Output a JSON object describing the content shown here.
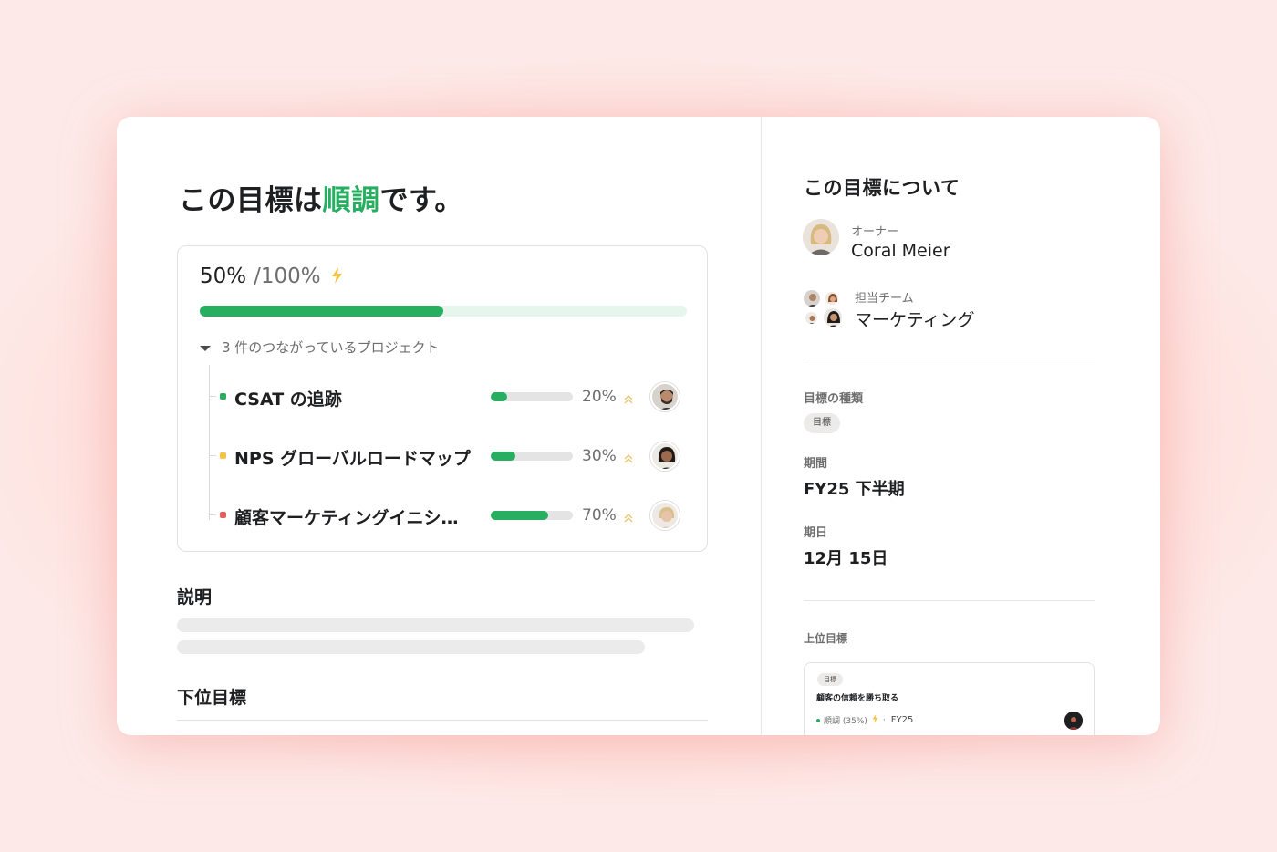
{
  "colors": {
    "accent_green": "#27ae60",
    "warning_yellow": "#f5c242",
    "danger_red": "#ec5d5d",
    "page_background": "#fde9e7"
  },
  "main": {
    "headline_prefix": "この目標は",
    "headline_status": "順調",
    "headline_suffix": "です。",
    "progress": {
      "current": "50%",
      "total": "/100%",
      "value": 0.5,
      "icon": "lightning-bolt-icon"
    },
    "projects_toggle": "3 件のつながっているプロジェクト",
    "projects": [
      {
        "name": "CSAT の追跡",
        "status": "green",
        "value": 0.2,
        "pct": "20%"
      },
      {
        "name": "NPS グローバルロードマップ",
        "status": "yellow",
        "value": 0.3,
        "pct": "30%"
      },
      {
        "name": "顧客マーケティングイニシ…",
        "status": "red",
        "value": 0.7,
        "pct": "70%"
      }
    ],
    "description_title": "説明",
    "subgoals_title": "下位目標"
  },
  "sidebar": {
    "title": "この目標について",
    "owner_label": "オーナー",
    "owner_name": "Coral Meier",
    "team_label": "担当チーム",
    "team_name": "マーケティング",
    "goal_type_label": "目標の種類",
    "goal_type_value": "目標",
    "period_label": "期間",
    "period_value": "FY25 下半期",
    "due_label": "期日",
    "due_value": "12月 15日",
    "parent_label": "上位目標",
    "parent": {
      "chip": "目標",
      "name": "顧客の信頼を勝ち取る",
      "status": "順調 (35%)",
      "value": 0.35,
      "separator": "·",
      "period": "FY25"
    }
  }
}
